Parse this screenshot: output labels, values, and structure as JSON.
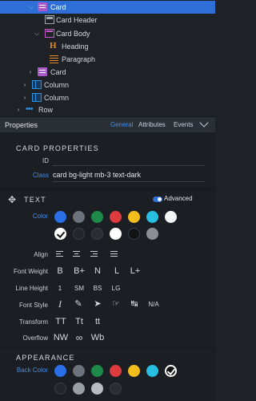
{
  "tree": {
    "items": [
      {
        "label": "Card",
        "icon": "card-icon",
        "selected": true
      },
      {
        "label": "Card Header",
        "icon": "card-header-icon"
      },
      {
        "label": "Card Body",
        "icon": "card-body-icon"
      },
      {
        "label": "Heading",
        "icon": "heading-icon"
      },
      {
        "label": "Paragraph",
        "icon": "paragraph-icon"
      },
      {
        "label": "Card",
        "icon": "card-icon"
      },
      {
        "label": "Column",
        "icon": "column-icon"
      },
      {
        "label": "Column",
        "icon": "column-icon"
      },
      {
        "label": "Row",
        "icon": "row-icon"
      }
    ]
  },
  "properties": {
    "title": "Properties",
    "tabs": [
      "General",
      "Attributes",
      "Events"
    ],
    "active_tab": "General"
  },
  "card_properties": {
    "title": "CARD PROPERTIES",
    "id_label": "ID",
    "id_value": "",
    "class_label": "Class",
    "class_value": "card bg-light mb-3 text-dark"
  },
  "text": {
    "title": "TEXT",
    "advanced_label": "Advanced",
    "color_label": "Color",
    "colors_row1": [
      "#2b6fe6",
      "#6c737c",
      "#1d8a4a",
      "#dd3b3e",
      "#f2bd1c",
      "#27bfe0",
      "#f4f5f7"
    ],
    "colors_row2": [
      "#ffffff",
      "#23272c",
      "#2a2e33",
      "#ffffff",
      "#111316",
      "#8a8f96"
    ],
    "align_label": "Align",
    "font_weight_label": "Font Weight",
    "font_weights": [
      "B",
      "B+",
      "N",
      "L",
      "L+"
    ],
    "line_height_label": "Line Height",
    "line_heights": [
      "1",
      "SM",
      "BS",
      "LG"
    ],
    "font_style_label": "Font Style",
    "font_style_na": "N/A",
    "transform_label": "Transform",
    "transforms": [
      "TT",
      "Tt",
      "tt"
    ],
    "overflow_label": "Overflow",
    "overflows": [
      "NW",
      "∞",
      "Wb"
    ]
  },
  "appearance": {
    "title": "APPEARANCE",
    "back_color_label": "Back Color",
    "colors_row1": [
      "#2b6fe6",
      "#6c737c",
      "#1d8a4a",
      "#dd3b3e",
      "#f2bd1c",
      "#27bfe0",
      "#111316"
    ],
    "colors_row2": [
      "#23272c",
      "#9a9fa6",
      "#b8bcc2",
      "#2a2e33"
    ]
  }
}
